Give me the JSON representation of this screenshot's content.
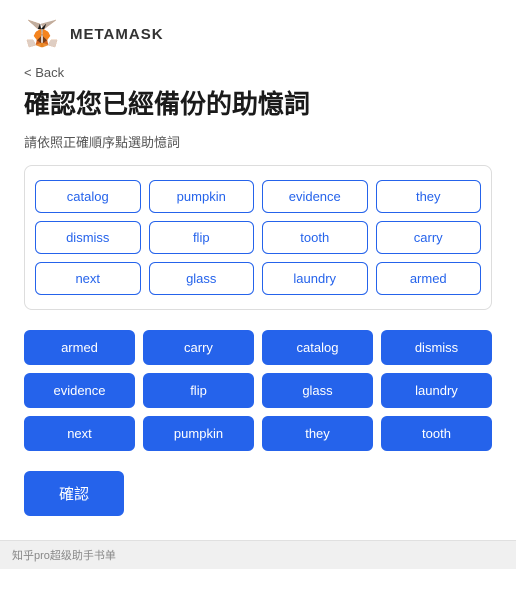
{
  "header": {
    "logo_alt": "MetaMask Fox",
    "brand_label": "METAMASK"
  },
  "nav": {
    "back_label": "Back"
  },
  "page": {
    "title": "確認您已經備份的助憶詞",
    "subtitle": "請依照正確順序點選助憶詞"
  },
  "word_pool": {
    "words": [
      "catalog",
      "pumpkin",
      "evidence",
      "they",
      "dismiss",
      "flip",
      "tooth",
      "carry",
      "next",
      "glass",
      "laundry",
      "armed"
    ]
  },
  "selected_words": {
    "words": [
      "armed",
      "carry",
      "catalog",
      "dismiss",
      "evidence",
      "flip",
      "glass",
      "laundry",
      "next",
      "pumpkin",
      "they",
      "tooth"
    ]
  },
  "actions": {
    "confirm_label": "確認"
  },
  "bottom_bar": {
    "text": "知乎pro超级助手书单"
  }
}
